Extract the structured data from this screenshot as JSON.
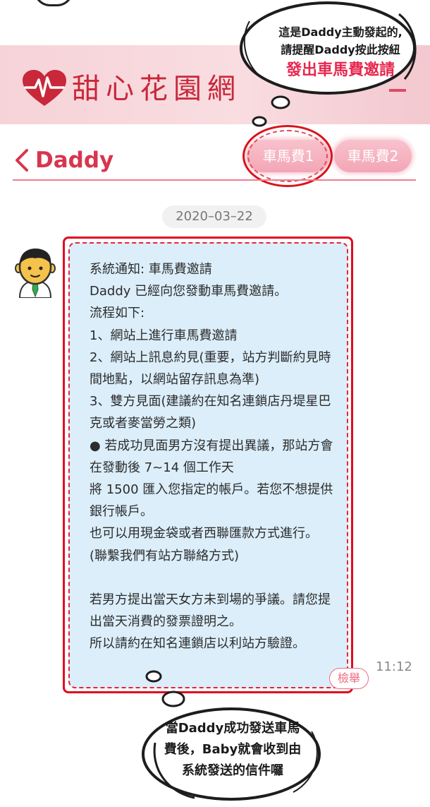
{
  "header": {
    "site_name": "甜心花園網"
  },
  "nav": {
    "title": "Daddy",
    "fare_button_1": "車馬費1",
    "fare_button_2": "車馬費2"
  },
  "chat": {
    "date": "2020–03–22",
    "message": "系統通知: 車馬費邀請\nDaddy 已經向您發動車馬費邀請。\n流程如下:\n1、網站上進行車馬費邀請\n2、網站上訊息約見(重要，站方判斷約見時間地點，以網站留存訊息為準)\n3、雙方見面(建議約在知名連鎖店丹堤星巴克或者麥當勞之類)\n● 若成功見面男方沒有提出異議，那站方會在發動後 7~14 個工作天\n將 1500 匯入您指定的帳戶。若您不想提供銀行帳戶。\n也可以用現金袋或者西聯匯款方式進行。\n(聯繫我們有站方聯絡方式)\n\n若男方提出當天女方未到場的爭議。請您提出當天消費的發票證明之。\n所以請約在知名連鎖店以利站方驗證。",
    "report_label": "檢舉",
    "time": "11:12"
  },
  "callouts": {
    "top_line1": "這是Daddy主動發起的,",
    "top_line2": "請提醒Daddy按此按紐",
    "top_highlight": "發出車馬費邀請",
    "bottom_line1": "當Daddy成功發送車馬",
    "bottom_line2": "費後，Baby就會收到由",
    "bottom_line3": "系統發送的信件囉"
  },
  "colors": {
    "brand_red": "#d8354f",
    "highlight_red": "#e10a1e",
    "bubble_blue": "#dbeefa",
    "fare_pink": "#f3a6b5"
  },
  "icons": {
    "logo": "heart-pulse-icon",
    "back": "chevron-left-icon",
    "avatar": "person-avatar-icon"
  }
}
